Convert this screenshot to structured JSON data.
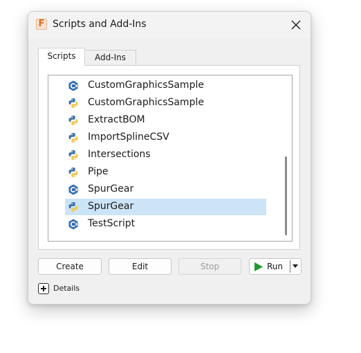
{
  "window": {
    "title": "Scripts and Add-Ins",
    "app_icon_letter": "F",
    "close_icon": "close-icon"
  },
  "tabs": [
    {
      "label": "Scripts",
      "active": true
    },
    {
      "label": "Add-Ins",
      "active": false
    }
  ],
  "scripts": [
    {
      "name": "CustomGraphicsSample",
      "icon": "csharp-icon",
      "selected": false
    },
    {
      "name": "CustomGraphicsSample",
      "icon": "python-icon",
      "selected": false
    },
    {
      "name": "ExtractBOM",
      "icon": "python-icon",
      "selected": false
    },
    {
      "name": "ImportSplineCSV",
      "icon": "python-icon",
      "selected": false
    },
    {
      "name": "Intersections",
      "icon": "python-icon",
      "selected": false
    },
    {
      "name": "Pipe",
      "icon": "python-icon",
      "selected": false
    },
    {
      "name": "SpurGear",
      "icon": "csharp-icon",
      "selected": false
    },
    {
      "name": "SpurGear",
      "icon": "python-icon",
      "selected": true
    },
    {
      "name": "TestScript",
      "icon": "csharp-icon",
      "selected": false
    }
  ],
  "buttons": {
    "create": "Create",
    "edit": "Edit",
    "stop": "Stop",
    "run": "Run"
  },
  "details": {
    "label": "Details"
  },
  "colors": {
    "selection": "#cce4f7",
    "run_green": "#1a9c2a",
    "python_blue": "#3a72a8",
    "python_yellow": "#f2c94c",
    "csharp_blue": "#2f6db5"
  }
}
